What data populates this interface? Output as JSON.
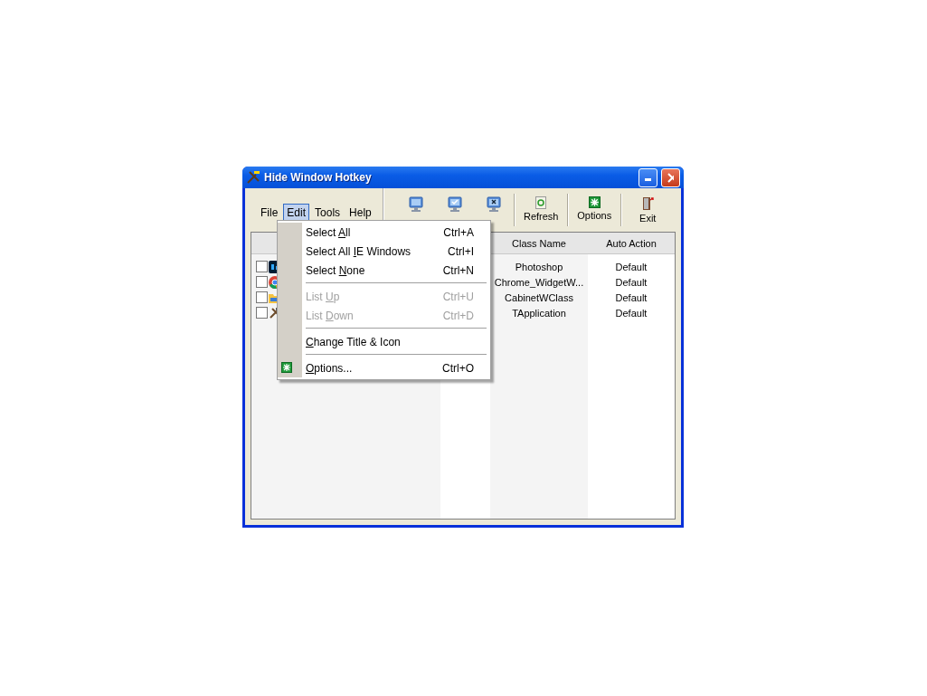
{
  "window": {
    "title": "Hide Window Hotkey"
  },
  "menu_bar": [
    {
      "label": "File",
      "selected": false
    },
    {
      "label": "Edit",
      "selected": true
    },
    {
      "label": "Tools",
      "selected": false
    },
    {
      "label": "Help",
      "selected": false
    }
  ],
  "toolbar": [
    {
      "kind": "hide"
    },
    {
      "kind": "show"
    },
    {
      "kind": "close"
    },
    {
      "kind": "separator"
    },
    {
      "kind": "refresh",
      "label": "Refresh"
    },
    {
      "kind": "separator"
    },
    {
      "kind": "options",
      "label": "Options"
    },
    {
      "kind": "separator"
    },
    {
      "kind": "exit",
      "label": "Exit"
    }
  ],
  "table": {
    "columns": [
      "Class Name",
      "Auto Action"
    ],
    "rows": [
      {
        "checked": false,
        "kind": "photoshop",
        "class_name": "Photoshop",
        "auto_action": "Default"
      },
      {
        "checked": false,
        "kind": "chrome",
        "class_name": "Chrome_WidgetW...",
        "auto_action": "Default"
      },
      {
        "checked": false,
        "kind": "folder",
        "class_name": "CabinetWClass",
        "auto_action": "Default"
      },
      {
        "checked": false,
        "kind": "tools",
        "class_name": "TApplication",
        "auto_action": "Default"
      }
    ]
  },
  "edit_menu": [
    {
      "kind": "item",
      "pre": "Select ",
      "key": "A",
      "post": "ll",
      "shortcut": "Ctrl+A",
      "disabled": false
    },
    {
      "kind": "item",
      "pre": "Select All ",
      "key": "I",
      "post": "E Windows",
      "shortcut": "Ctrl+I",
      "disabled": false
    },
    {
      "kind": "item",
      "pre": "Select ",
      "key": "N",
      "post": "one",
      "shortcut": "Ctrl+N",
      "disabled": false
    },
    {
      "kind": "separator"
    },
    {
      "kind": "item",
      "pre": "List ",
      "key": "U",
      "post": "p",
      "shortcut": "Ctrl+U",
      "disabled": true
    },
    {
      "kind": "item",
      "pre": "List ",
      "key": "D",
      "post": "own",
      "shortcut": "Ctrl+D",
      "disabled": true
    },
    {
      "kind": "separator"
    },
    {
      "kind": "item",
      "key": "C",
      "post": "hange Title & Icon",
      "disabled": false
    },
    {
      "kind": "separator"
    },
    {
      "kind": "options",
      "key": "O",
      "post": "ptions...",
      "shortcut": "Ctrl+O",
      "disabled": false
    }
  ]
}
